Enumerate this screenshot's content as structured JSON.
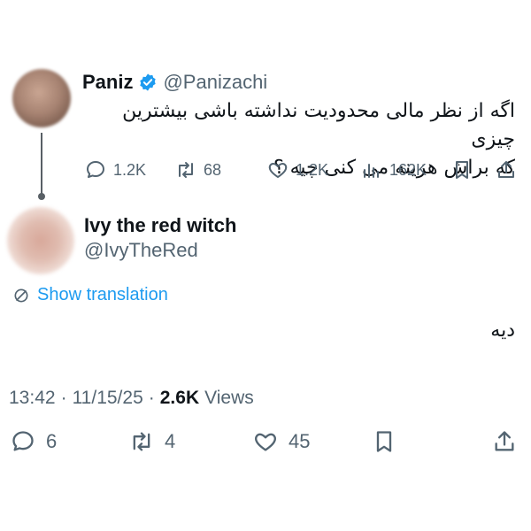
{
  "quoted": {
    "author_name": "Paniz",
    "author_handle": "@Panizachi",
    "text_line1": "اگه از نظر مالی محدودیت نداشته باشی بیشترین چیزی",
    "text_line2": "که براش هزینه می کنی چیه ؟",
    "actions": {
      "reply_count": "1.2K",
      "retweet_count": "68",
      "like_count": "1.2K",
      "view_count": "162K"
    },
    "icons": [
      "verified-badge-icon",
      "reply-icon",
      "retweet-icon",
      "like-icon",
      "views-icon",
      "bookmark-icon",
      "share-icon"
    ]
  },
  "reply": {
    "author_name": "Ivy the red witch",
    "author_handle": "@IvyTheRed",
    "translation_label": "Show translation",
    "text": "دیه",
    "time": "13:42",
    "date": "11/15/25",
    "separator": "·",
    "views_count": "2.6K",
    "views_label": "Views",
    "actions": {
      "reply_count": "6",
      "retweet_count": "4",
      "like_count": "45"
    }
  },
  "colors": {
    "text": "#0f1419",
    "muted": "#536471",
    "link": "#1d9bf0",
    "verified": "#1d9bf0"
  }
}
